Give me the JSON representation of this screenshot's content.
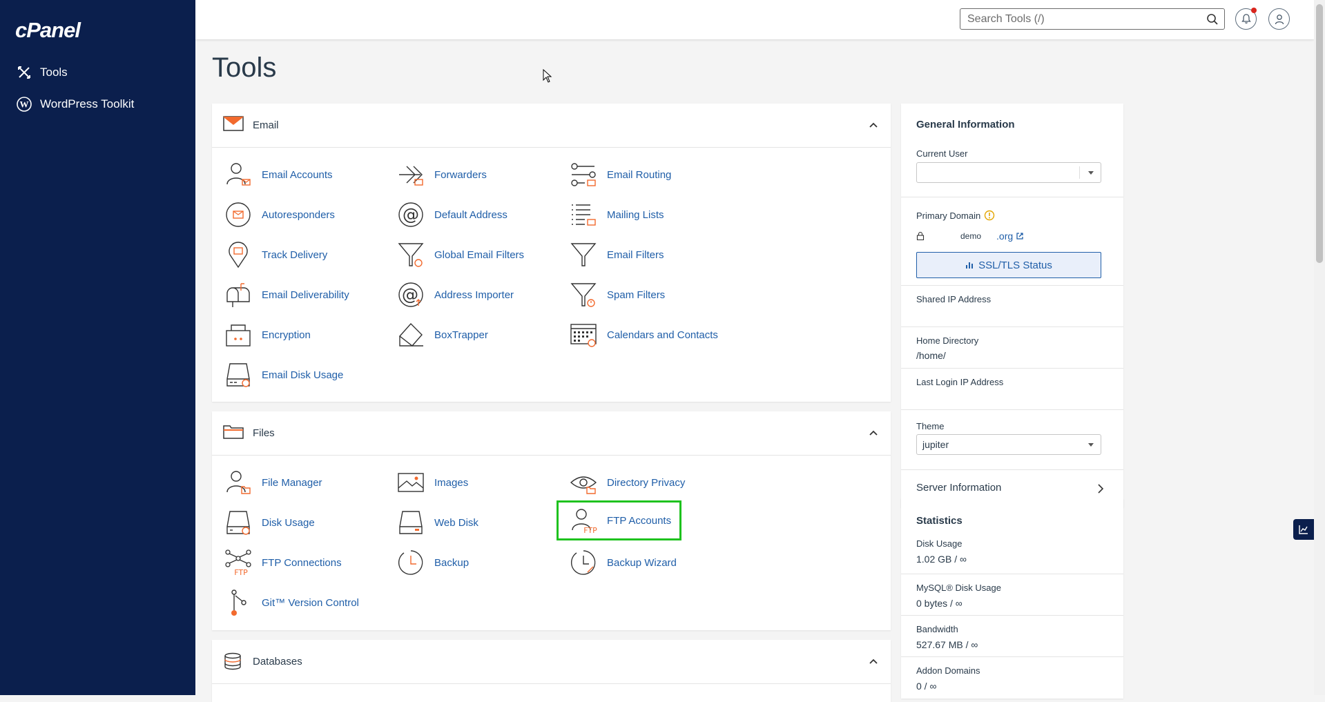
{
  "sidebar": {
    "logo": "cPanel",
    "items": [
      {
        "label": "Tools",
        "icon": "tools-icon"
      },
      {
        "label": "WordPress Toolkit",
        "icon": "wordpress-icon"
      }
    ]
  },
  "topbar": {
    "search_placeholder": "Search Tools (/)",
    "notifications_icon": "bell-icon",
    "user_icon": "user-icon"
  },
  "page": {
    "title": "Tools"
  },
  "sections": {
    "email": {
      "title": "Email",
      "tools": [
        {
          "label": "Email Accounts",
          "icon": "email-accounts-icon"
        },
        {
          "label": "Forwarders",
          "icon": "forwarders-icon"
        },
        {
          "label": "Email Routing",
          "icon": "email-routing-icon"
        },
        {
          "label": "Autoresponders",
          "icon": "autoresponders-icon"
        },
        {
          "label": "Default Address",
          "icon": "default-address-icon"
        },
        {
          "label": "Mailing Lists",
          "icon": "mailing-lists-icon"
        },
        {
          "label": "Track Delivery",
          "icon": "track-delivery-icon"
        },
        {
          "label": "Global Email Filters",
          "icon": "global-email-filters-icon"
        },
        {
          "label": "Email Filters",
          "icon": "email-filters-icon"
        },
        {
          "label": "Email Deliverability",
          "icon": "email-deliverability-icon"
        },
        {
          "label": "Address Importer",
          "icon": "address-importer-icon"
        },
        {
          "label": "Spam Filters",
          "icon": "spam-filters-icon"
        },
        {
          "label": "Encryption",
          "icon": "encryption-icon"
        },
        {
          "label": "BoxTrapper",
          "icon": "boxtrapper-icon"
        },
        {
          "label": "Calendars and Contacts",
          "icon": "calendars-icon"
        },
        {
          "label": "Email Disk Usage",
          "icon": "email-disk-usage-icon"
        }
      ]
    },
    "files": {
      "title": "Files",
      "tools": [
        {
          "label": "File Manager",
          "icon": "file-manager-icon"
        },
        {
          "label": "Images",
          "icon": "images-icon"
        },
        {
          "label": "Directory Privacy",
          "icon": "directory-privacy-icon"
        },
        {
          "label": "Disk Usage",
          "icon": "disk-usage-icon"
        },
        {
          "label": "Web Disk",
          "icon": "web-disk-icon"
        },
        {
          "label": "FTP Accounts",
          "icon": "ftp-accounts-icon"
        },
        {
          "label": "FTP Connections",
          "icon": "ftp-connections-icon"
        },
        {
          "label": "Backup",
          "icon": "backup-icon"
        },
        {
          "label": "Backup Wizard",
          "icon": "backup-wizard-icon"
        },
        {
          "label": "Git™ Version Control",
          "icon": "git-icon"
        }
      ]
    },
    "databases": {
      "title": "Databases"
    }
  },
  "general_info": {
    "title": "General Information",
    "current_user_label": "Current User",
    "current_user_value": "",
    "primary_domain_label": "Primary Domain",
    "domain_name": "demo",
    "domain_tld": ".org",
    "ssl_button": "SSL/TLS Status",
    "shared_ip_label": "Shared IP Address",
    "shared_ip_value": "",
    "home_dir_label": "Home Directory",
    "home_dir_value": "/home/",
    "last_login_label": "Last Login IP Address",
    "last_login_value": "",
    "theme_label": "Theme",
    "theme_value": "jupiter",
    "server_info": "Server Information"
  },
  "statistics": {
    "title": "Statistics",
    "items": [
      {
        "label": "Disk Usage",
        "value": "1.02 GB / ∞"
      },
      {
        "label": "MySQL® Disk Usage",
        "value": "0 bytes / ∞"
      },
      {
        "label": "Bandwidth",
        "value": "527.67 MB / ∞"
      },
      {
        "label": "Addon Domains",
        "value": "0 / ∞"
      }
    ]
  },
  "colors": {
    "sidebar_bg": "#0b1f4d",
    "link": "#1f5ea8",
    "icon_orange": "#f26a2e",
    "highlight": "#1ec21e"
  }
}
